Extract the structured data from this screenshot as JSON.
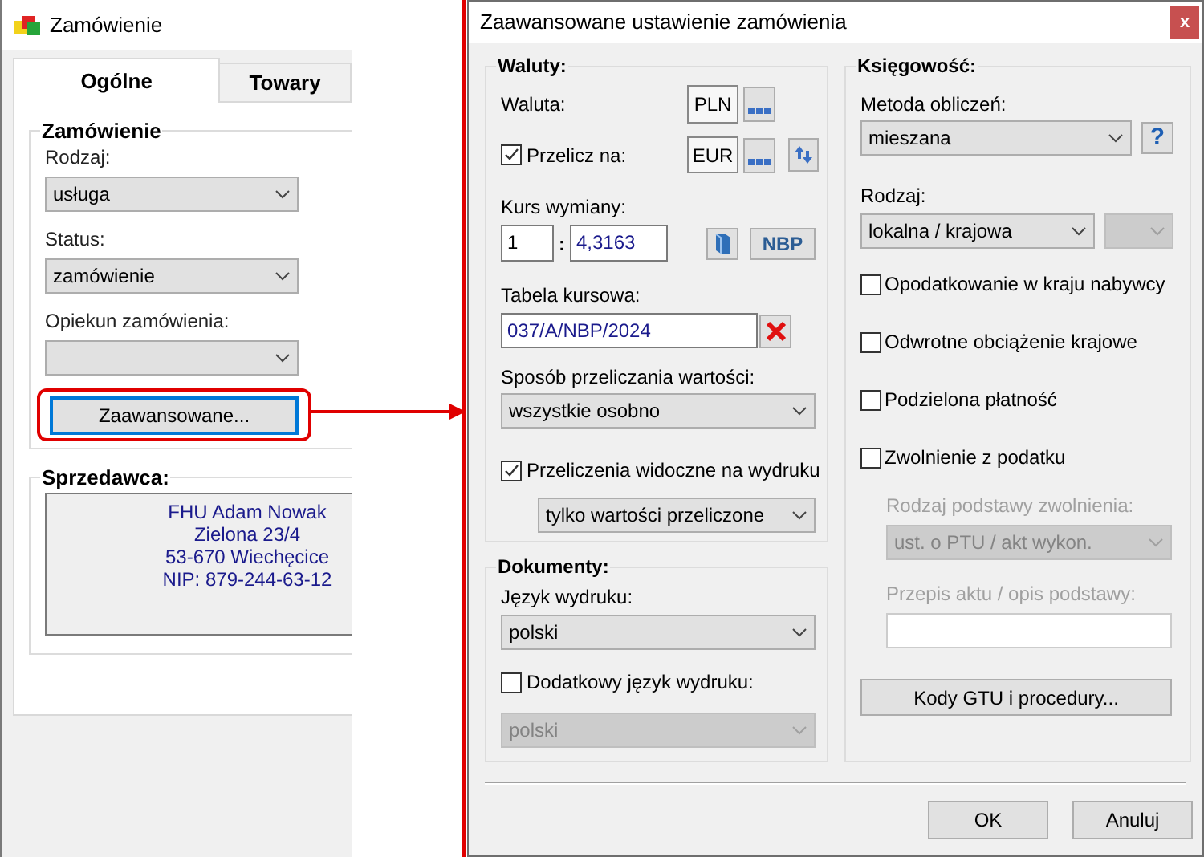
{
  "main_window": {
    "title": "Zamówienie",
    "tabs": [
      {
        "label": "Ogólne",
        "selected": true
      },
      {
        "label": "Towary",
        "selected": false
      }
    ],
    "order": {
      "title": "Zamówienie",
      "fields": [
        {
          "label": "Rodzaj:",
          "value": "usługa"
        },
        {
          "label": "Status:",
          "value": "zamówienie"
        },
        {
          "label": "Opiekun zamówienia:"
        }
      ],
      "advanced_button": {
        "label": "Zaawansowane...",
        "highlighted": true
      }
    },
    "seller": {
      "title": "Sprzedawca:",
      "lines": [
        "FHU Adam Nowak",
        "Zielona 23/4",
        "53-670 Wiechęcice",
        "NIP: 879-244-63-12"
      ]
    }
  },
  "dialog": {
    "title": "Zaawansowane ustawienie zamówienia",
    "close_button": "x",
    "currencies": {
      "title": "Waluty:",
      "currency_label": "Waluta:",
      "currency": "PLN",
      "convert": {
        "label": "Przelicz na:",
        "checked": true,
        "currency": "EUR"
      },
      "rate_label": "Kurs wymiany:",
      "rate_from": "1",
      "rate_separator": ":",
      "rate_to": "4,3163",
      "nbp_button": "NBP",
      "table_label": "Tabela kursowa:",
      "table_value": "037/A/NBP/2024",
      "method_label": "Sposób przeliczania wartości:",
      "method": "wszystkie osobno",
      "print": {
        "label": "Przeliczenia widoczne na wydruku",
        "checked": true,
        "value": "tylko wartości przeliczone"
      }
    },
    "documents": {
      "title": "Dokumenty:",
      "language_label": "Język wydruku:",
      "language": "polski",
      "extra_language": {
        "label": "Dodatkowy język wydruku:",
        "checked": false,
        "value": "polski",
        "disabled": true
      }
    },
    "accounting": {
      "title": "Księgowość:",
      "method_label": "Metoda obliczeń:",
      "method": "mieszana",
      "help_button": "?",
      "kind_label": "Rodzaj:",
      "kind": "lokalna / krajowa",
      "kind_secondary_disabled": true,
      "options": [
        {
          "label": "Opodatkowanie w kraju nabywcy",
          "checked": false
        },
        {
          "label": "Odwrotne obciążenie krajowe",
          "checked": false
        },
        {
          "label": "Podzielona płatność",
          "checked": false
        },
        {
          "label": "Zwolnienie z podatku",
          "checked": false
        }
      ],
      "exemption": {
        "disabled": true,
        "basis_label": "Rodzaj podstawy zwolnienia:",
        "basis": "ust. o PTU / akt wykon.",
        "provision_label": "Przepis aktu / opis podstawy:"
      },
      "gtu_button": "Kody GTU i procedury..."
    },
    "buttons": [
      "OK",
      "Anuluj"
    ]
  }
}
